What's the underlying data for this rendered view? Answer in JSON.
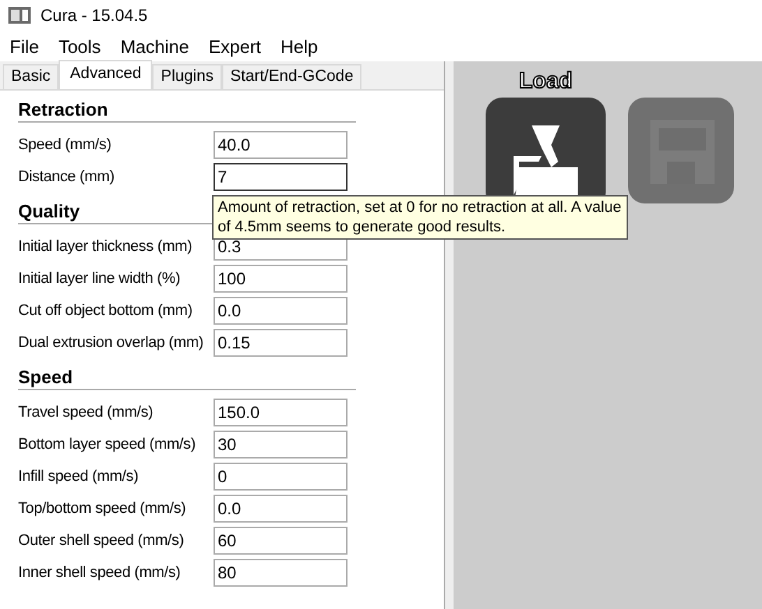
{
  "window": {
    "title": "Cura - 15.04.5"
  },
  "menu": [
    "File",
    "Tools",
    "Machine",
    "Expert",
    "Help"
  ],
  "tabs": [
    {
      "label": "Basic",
      "selected": false
    },
    {
      "label": "Advanced",
      "selected": true
    },
    {
      "label": "Plugins",
      "selected": false
    },
    {
      "label": "Start/End-GCode",
      "selected": false
    }
  ],
  "sections": [
    {
      "title": "Retraction",
      "fields": [
        {
          "label": "Speed (mm/s)",
          "value": "40.0",
          "focused": false
        },
        {
          "label": "Distance (mm)",
          "value": "7",
          "focused": true
        }
      ]
    },
    {
      "title": "Quality",
      "fields": [
        {
          "label": "Initial layer thickness (mm)",
          "value": "0.3",
          "focused": false
        },
        {
          "label": "Initial layer line width (%)",
          "value": "100",
          "focused": false
        },
        {
          "label": "Cut off object bottom (mm)",
          "value": "0.0",
          "focused": false
        },
        {
          "label": "Dual extrusion overlap (mm)",
          "value": "0.15",
          "focused": false
        }
      ]
    },
    {
      "title": "Speed",
      "fields": [
        {
          "label": "Travel speed (mm/s)",
          "value": "150.0",
          "focused": false
        },
        {
          "label": "Bottom layer speed (mm/s)",
          "value": "30",
          "focused": false
        },
        {
          "label": "Infill speed (mm/s)",
          "value": "0",
          "focused": false
        },
        {
          "label": "Top/bottom speed (mm/s)",
          "value": "0.0",
          "focused": false
        },
        {
          "label": "Outer shell speed (mm/s)",
          "value": "60",
          "focused": false
        },
        {
          "label": "Inner shell speed (mm/s)",
          "value": "80",
          "focused": false
        }
      ]
    }
  ],
  "tooltip": "Amount of retraction, set at 0 for no retraction at all. A value of 4.5mm seems to generate good results.",
  "viewer": {
    "load_label": "Load",
    "save_disabled": true
  }
}
